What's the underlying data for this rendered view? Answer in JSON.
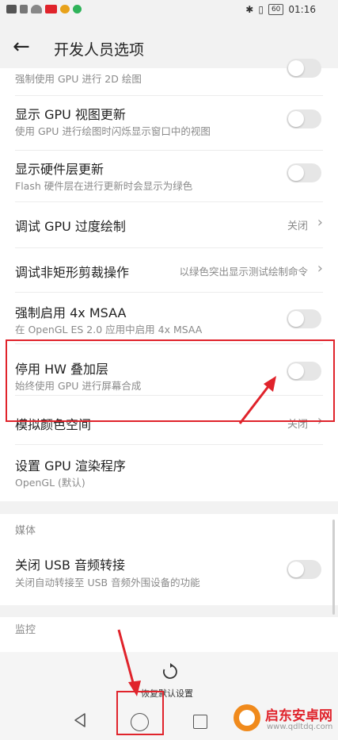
{
  "status_bar": {
    "time": "01:16",
    "battery": "60"
  },
  "header": {
    "title": "开发人员选项"
  },
  "settings": [
    {
      "title": "",
      "subtitle": "强制使用 GPU 进行 2D 绘图"
    },
    {
      "title": "显示 GPU 视图更新",
      "subtitle": "使用 GPU 进行绘图时闪烁显示窗口中的视图"
    },
    {
      "title": "显示硬件层更新",
      "subtitle": "Flash 硬件层在进行更新时会显示为绿色"
    },
    {
      "title": "调试 GPU 过度绘制",
      "value": "关闭"
    },
    {
      "title": "调试非矩形剪裁操作",
      "value": "以绿色突出显示测试绘制命令"
    },
    {
      "title": "强制启用 4x MSAA",
      "subtitle": "在 OpenGL ES 2.0 应用中启用 4x MSAA"
    },
    {
      "title": "停用 HW 叠加层",
      "subtitle": "始终使用 GPU 进行屏幕合成"
    },
    {
      "title": "模拟颜色空间",
      "value": "关闭"
    },
    {
      "title": "设置 GPU 渲染程序",
      "subtitle": "OpenGL (默认)"
    }
  ],
  "media_section": {
    "label": "媒体",
    "items": [
      {
        "title": "关闭 USB 音频转接",
        "subtitle": "关闭自动转接至 USB 音频外围设备的功能"
      }
    ]
  },
  "monitor_section": {
    "label": "监控"
  },
  "bottom_action": {
    "label": "恢复默认设置"
  },
  "watermark": {
    "title": "启东安卓网",
    "url": "www.qdltdq.com"
  },
  "colors": {
    "annotation": "#e0232b",
    "toggle_off": "#e6e6e6",
    "watermark_orange": "#f08a1c"
  }
}
